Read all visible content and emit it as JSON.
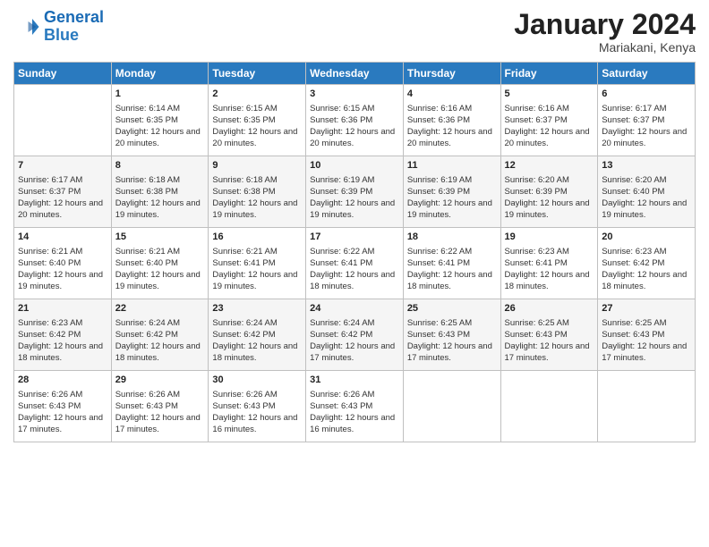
{
  "logo": {
    "line1": "General",
    "line2": "Blue"
  },
  "title": "January 2024",
  "location": "Mariakani, Kenya",
  "columns": [
    "Sunday",
    "Monday",
    "Tuesday",
    "Wednesday",
    "Thursday",
    "Friday",
    "Saturday"
  ],
  "weeks": [
    [
      {
        "day": "",
        "info": ""
      },
      {
        "day": "1",
        "info": "Sunrise: 6:14 AM\nSunset: 6:35 PM\nDaylight: 12 hours and 20 minutes."
      },
      {
        "day": "2",
        "info": "Sunrise: 6:15 AM\nSunset: 6:35 PM\nDaylight: 12 hours and 20 minutes."
      },
      {
        "day": "3",
        "info": "Sunrise: 6:15 AM\nSunset: 6:36 PM\nDaylight: 12 hours and 20 minutes."
      },
      {
        "day": "4",
        "info": "Sunrise: 6:16 AM\nSunset: 6:36 PM\nDaylight: 12 hours and 20 minutes."
      },
      {
        "day": "5",
        "info": "Sunrise: 6:16 AM\nSunset: 6:37 PM\nDaylight: 12 hours and 20 minutes."
      },
      {
        "day": "6",
        "info": "Sunrise: 6:17 AM\nSunset: 6:37 PM\nDaylight: 12 hours and 20 minutes."
      }
    ],
    [
      {
        "day": "7",
        "info": "Sunrise: 6:17 AM\nSunset: 6:37 PM\nDaylight: 12 hours and 20 minutes."
      },
      {
        "day": "8",
        "info": "Sunrise: 6:18 AM\nSunset: 6:38 PM\nDaylight: 12 hours and 19 minutes."
      },
      {
        "day": "9",
        "info": "Sunrise: 6:18 AM\nSunset: 6:38 PM\nDaylight: 12 hours and 19 minutes."
      },
      {
        "day": "10",
        "info": "Sunrise: 6:19 AM\nSunset: 6:39 PM\nDaylight: 12 hours and 19 minutes."
      },
      {
        "day": "11",
        "info": "Sunrise: 6:19 AM\nSunset: 6:39 PM\nDaylight: 12 hours and 19 minutes."
      },
      {
        "day": "12",
        "info": "Sunrise: 6:20 AM\nSunset: 6:39 PM\nDaylight: 12 hours and 19 minutes."
      },
      {
        "day": "13",
        "info": "Sunrise: 6:20 AM\nSunset: 6:40 PM\nDaylight: 12 hours and 19 minutes."
      }
    ],
    [
      {
        "day": "14",
        "info": "Sunrise: 6:21 AM\nSunset: 6:40 PM\nDaylight: 12 hours and 19 minutes."
      },
      {
        "day": "15",
        "info": "Sunrise: 6:21 AM\nSunset: 6:40 PM\nDaylight: 12 hours and 19 minutes."
      },
      {
        "day": "16",
        "info": "Sunrise: 6:21 AM\nSunset: 6:41 PM\nDaylight: 12 hours and 19 minutes."
      },
      {
        "day": "17",
        "info": "Sunrise: 6:22 AM\nSunset: 6:41 PM\nDaylight: 12 hours and 18 minutes."
      },
      {
        "day": "18",
        "info": "Sunrise: 6:22 AM\nSunset: 6:41 PM\nDaylight: 12 hours and 18 minutes."
      },
      {
        "day": "19",
        "info": "Sunrise: 6:23 AM\nSunset: 6:41 PM\nDaylight: 12 hours and 18 minutes."
      },
      {
        "day": "20",
        "info": "Sunrise: 6:23 AM\nSunset: 6:42 PM\nDaylight: 12 hours and 18 minutes."
      }
    ],
    [
      {
        "day": "21",
        "info": "Sunrise: 6:23 AM\nSunset: 6:42 PM\nDaylight: 12 hours and 18 minutes."
      },
      {
        "day": "22",
        "info": "Sunrise: 6:24 AM\nSunset: 6:42 PM\nDaylight: 12 hours and 18 minutes."
      },
      {
        "day": "23",
        "info": "Sunrise: 6:24 AM\nSunset: 6:42 PM\nDaylight: 12 hours and 18 minutes."
      },
      {
        "day": "24",
        "info": "Sunrise: 6:24 AM\nSunset: 6:42 PM\nDaylight: 12 hours and 17 minutes."
      },
      {
        "day": "25",
        "info": "Sunrise: 6:25 AM\nSunset: 6:43 PM\nDaylight: 12 hours and 17 minutes."
      },
      {
        "day": "26",
        "info": "Sunrise: 6:25 AM\nSunset: 6:43 PM\nDaylight: 12 hours and 17 minutes."
      },
      {
        "day": "27",
        "info": "Sunrise: 6:25 AM\nSunset: 6:43 PM\nDaylight: 12 hours and 17 minutes."
      }
    ],
    [
      {
        "day": "28",
        "info": "Sunrise: 6:26 AM\nSunset: 6:43 PM\nDaylight: 12 hours and 17 minutes."
      },
      {
        "day": "29",
        "info": "Sunrise: 6:26 AM\nSunset: 6:43 PM\nDaylight: 12 hours and 17 minutes."
      },
      {
        "day": "30",
        "info": "Sunrise: 6:26 AM\nSunset: 6:43 PM\nDaylight: 12 hours and 16 minutes."
      },
      {
        "day": "31",
        "info": "Sunrise: 6:26 AM\nSunset: 6:43 PM\nDaylight: 12 hours and 16 minutes."
      },
      {
        "day": "",
        "info": ""
      },
      {
        "day": "",
        "info": ""
      },
      {
        "day": "",
        "info": ""
      }
    ]
  ]
}
